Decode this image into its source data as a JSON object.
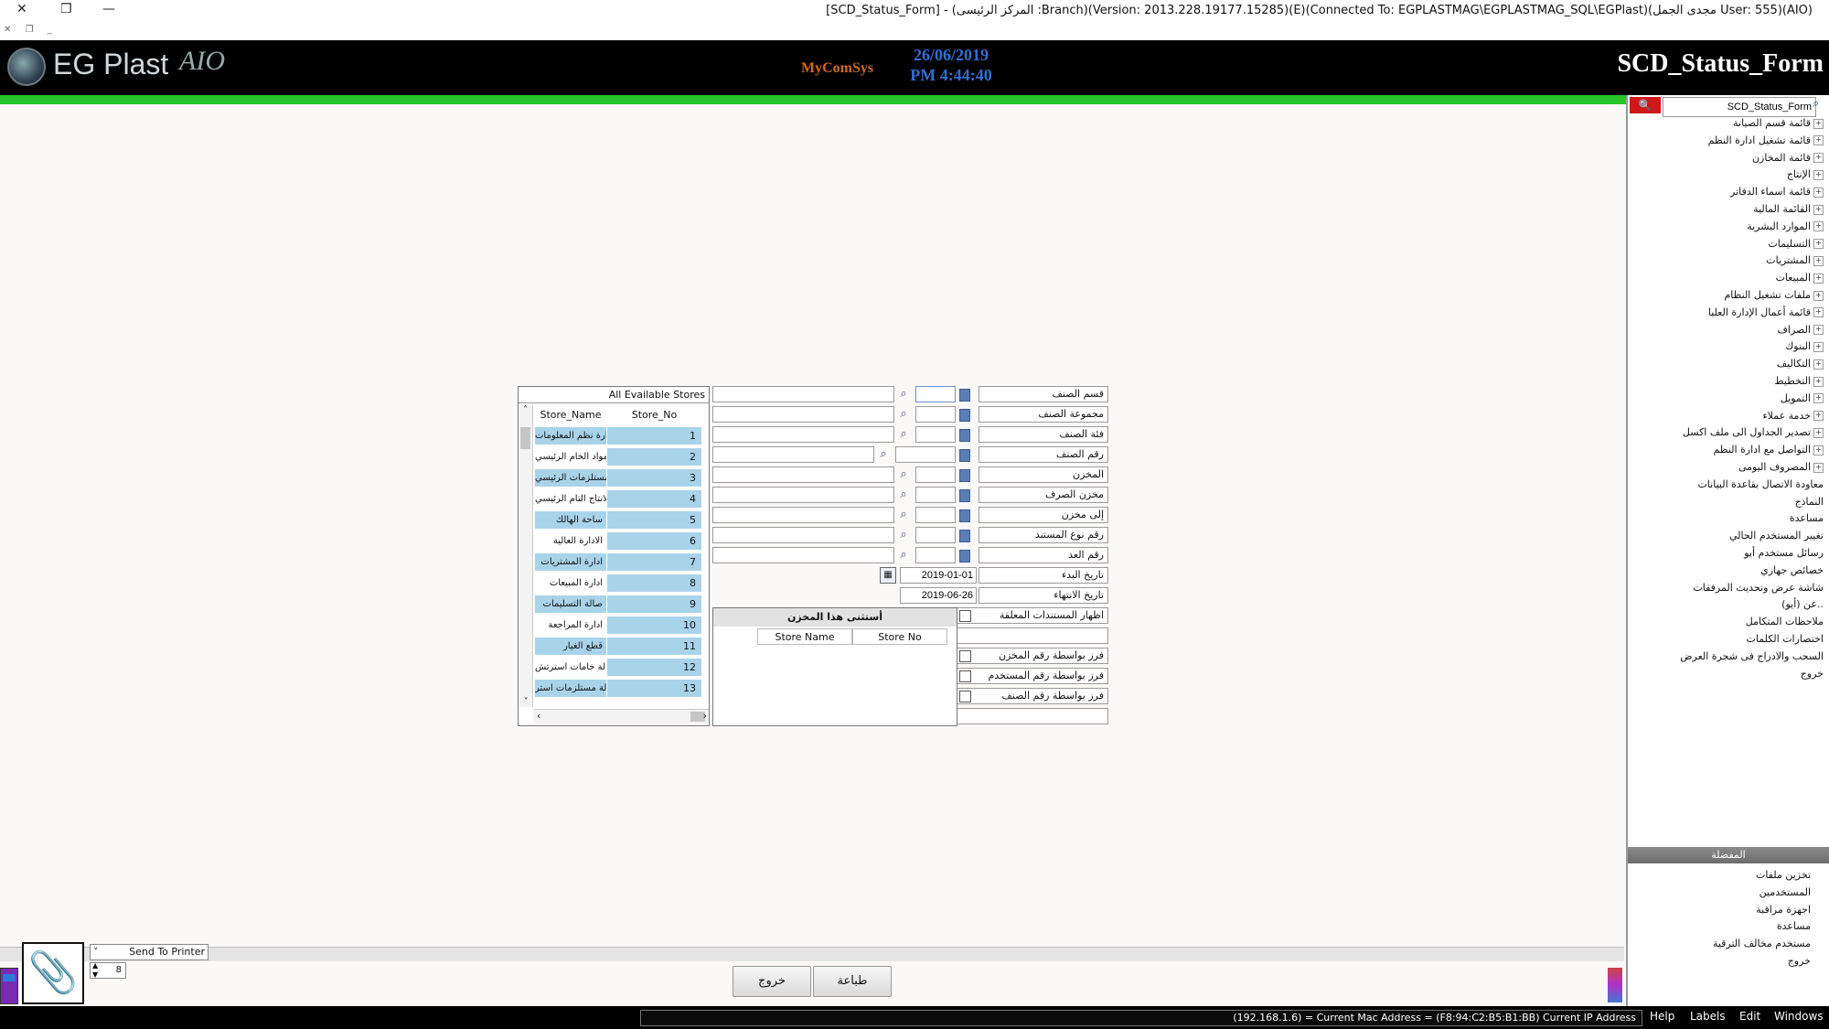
{
  "window": {
    "title": "[SCD_Status_Form] - (المركز الرئيسى :Branch)(Version: 2013.228.19177.15285)(E)(Connected To: EGPLASTMAG\\EGPLASTMAG_SQL\\EGPlast)(مجدى الجمل User: 555)(AIO)",
    "close_glyph": "✕",
    "restore_glyph": "❐",
    "minimize_glyph": "—"
  },
  "header": {
    "logo_text": "EG Plast",
    "logo_suffix": "AIO",
    "partner_logo": "MyComSys",
    "date": "26/06/2019",
    "time": "PM 4:44:40",
    "form_title": "SCD_Status_Form"
  },
  "sidebar": {
    "search_value": "SCD_Status_Form",
    "items": [
      {
        "label": "قائمة قسم الصيانة",
        "expandable": true
      },
      {
        "label": "قائمة تشغيل ادارة النظم",
        "expandable": true
      },
      {
        "label": "قائمة المخازن",
        "expandable": true
      },
      {
        "label": "الإنتاج",
        "expandable": true
      },
      {
        "label": "قائمة اسماء الدفاتر",
        "expandable": true
      },
      {
        "label": "القائمة المالية",
        "expandable": true
      },
      {
        "label": "الموارد البشرية",
        "expandable": true
      },
      {
        "label": "التسليمات",
        "expandable": true
      },
      {
        "label": "المشتريات",
        "expandable": true
      },
      {
        "label": "المبيعات",
        "expandable": true
      },
      {
        "label": "ملفات تشغيل النظام",
        "expandable": true
      },
      {
        "label": "قائمة أعمال الإدارة العليا",
        "expandable": true
      },
      {
        "label": "الصراف",
        "expandable": true
      },
      {
        "label": "البنوك",
        "expandable": true
      },
      {
        "label": "التكاليف",
        "expandable": true
      },
      {
        "label": "التخطيط",
        "expandable": true
      },
      {
        "label": "التمويل",
        "expandable": true
      },
      {
        "label": "خدمة عملاء",
        "expandable": true
      },
      {
        "label": "تصدير الجداول الى ملف اكسل",
        "expandable": true
      },
      {
        "label": "التواصل مع ادارة النظم",
        "expandable": true
      },
      {
        "label": "المصروف اليومى",
        "expandable": true
      },
      {
        "label": "معاودة الاتصال بقاعدة البيانات",
        "expandable": false
      },
      {
        "label": "النماذج",
        "expandable": false
      },
      {
        "label": "مساعدة",
        "expandable": false
      },
      {
        "label": "تغيير المستخدم الحالي",
        "expandable": false
      },
      {
        "label": "رسائل مستخدم أيو",
        "expandable": false
      },
      {
        "label": "خصائص جهازي",
        "expandable": false
      },
      {
        "label": "شاشة عرض وتحديث المرفقات",
        "expandable": false
      },
      {
        "label": "عن (أيو)..",
        "expandable": false
      },
      {
        "label": "ملاحظات المتكامل",
        "expandable": false
      },
      {
        "label": "اختصارات الكلمات",
        "expandable": false
      },
      {
        "label": "السحب والادراج فى شجرة العرض",
        "expandable": false
      },
      {
        "label": "خروج",
        "expandable": false
      }
    ],
    "favorites_title": "المفضلة",
    "favorites": [
      {
        "label": "تخزين ملفات"
      },
      {
        "label": "المستخدمين"
      },
      {
        "label": "اجهزة مراقبة"
      },
      {
        "label": "مساعدة"
      },
      {
        "label": "مستخدم مخالف الترقية"
      },
      {
        "label": "خروج"
      }
    ]
  },
  "form": {
    "labels": {
      "item_section": "قسم الصنف",
      "item_group": "مجموعة الصنف",
      "item_category": "فئة الصنف",
      "item_number": "رقم الصنف",
      "store": "المخزن",
      "issue_store": "مخزن الصرف",
      "to_store": "إلى مخزن",
      "doc_type_no": "رقم نوع المستند",
      "count_no": "رقم العد",
      "start_date": "تاريخ البدء",
      "end_date": "تاريخ الانتهاء",
      "show_pending": "اظهار المستندات المعلقة",
      "sort_by_store": "فرز بواسطة رقم المخزن",
      "sort_by_user": "فرز بواسطة رقم المستخدم",
      "sort_by_item": "فرز بواسطة رقم الصنف"
    },
    "values": {
      "start_date": "2019-01-01",
      "end_date": "2019-06-26"
    },
    "stores": {
      "title": "All Evailable Stores",
      "col_name": "Store_Name",
      "col_no": "Store_No",
      "rows": [
        {
          "name": "ادارة نظم المعلومات",
          "no": "1"
        },
        {
          "name": "المواد الخام الرئيسي",
          "no": "2"
        },
        {
          "name": "المستلزمات الرئيسي",
          "no": "3"
        },
        {
          "name": "الانتاج التام الرئيسي",
          "no": "4"
        },
        {
          "name": "ساحة الهالك",
          "no": "5"
        },
        {
          "name": "الادارة العالية",
          "no": "6"
        },
        {
          "name": "ادارة المشتريات",
          "no": "7"
        },
        {
          "name": "ادارة المبيعات",
          "no": "8"
        },
        {
          "name": "صالة التسليمات",
          "no": "9"
        },
        {
          "name": "ادارة المراجعة",
          "no": "10"
        },
        {
          "name": "قطع الغيار",
          "no": "11"
        },
        {
          "name": "صالة خامات استرتش",
          "no": "12"
        },
        {
          "name": "صالة مستلزمات استر",
          "no": "13"
        }
      ]
    },
    "except": {
      "title": "أستثنى هذا المخزن",
      "col_name": "Store Name",
      "col_no": "Store No"
    },
    "buttons": {
      "exit": "خروج",
      "print": "طباعة"
    }
  },
  "printer": {
    "destination": "Send To Printer",
    "copies": "8"
  },
  "statusbar": {
    "text": "(192.168.1.6) = Current Mac Address = (F8:94:C2:B5:B1:BB) Current IP Address",
    "menus": [
      "Help",
      "Labels",
      "Edit",
      "Windows"
    ]
  }
}
